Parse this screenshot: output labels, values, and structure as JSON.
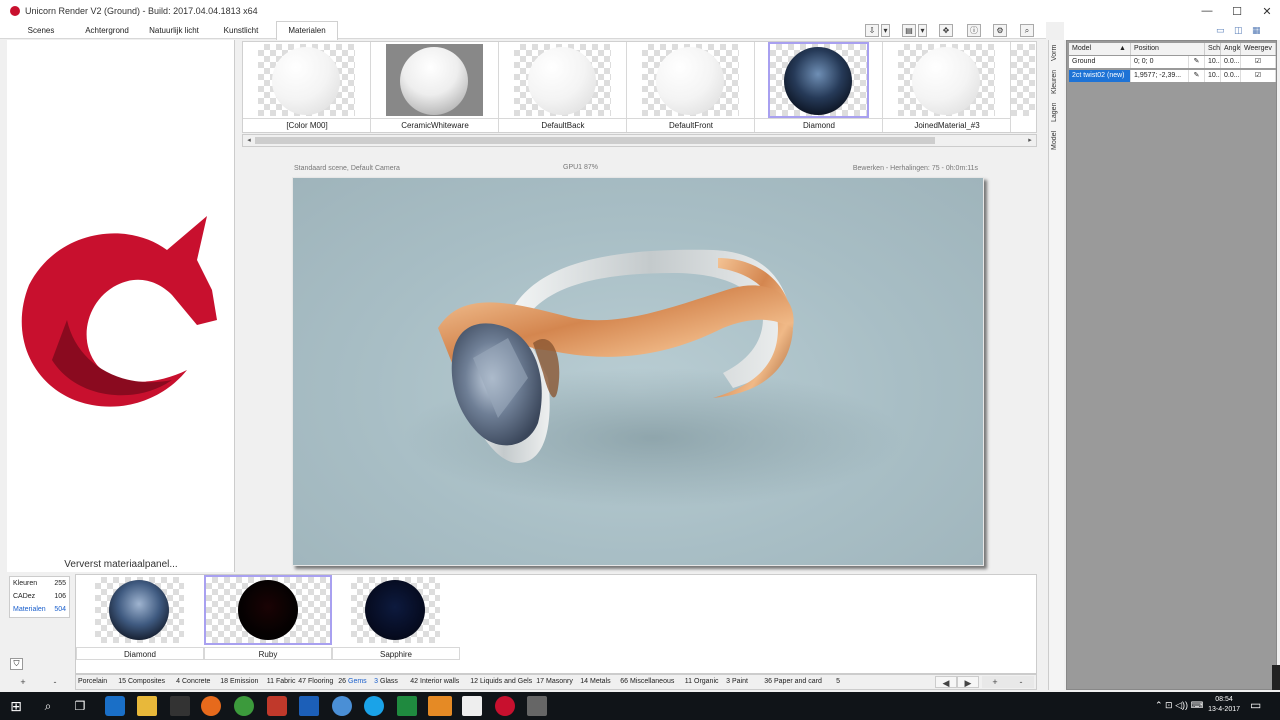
{
  "window": {
    "title": "Unicorn Render V2 (Ground) - Build: 2017.04.04.1813 x64",
    "minimize": "—",
    "maximize": "☐",
    "close": "✕"
  },
  "menu": {
    "tabs": [
      "Scenes",
      "Achtergrond",
      "Natuurlijk licht",
      "Kunstlicht",
      "Materialen"
    ],
    "active_index": 4
  },
  "materials_strip": {
    "items": [
      {
        "label": "[Color M00]",
        "ball": "white"
      },
      {
        "label": "CeramicWhiteware",
        "ball": "white-shadow"
      },
      {
        "label": "DefaultBack",
        "ball": "white"
      },
      {
        "label": "DefaultFront",
        "ball": "white"
      },
      {
        "label": "Diamond",
        "ball": "diamond"
      },
      {
        "label": "JoinedMaterial_#3",
        "ball": "white"
      }
    ],
    "selected_index": 4
  },
  "viewport": {
    "scene_info": "Standaard scene, Default Camera",
    "gpu_info": "GPU1 87%",
    "status_info": "Bewerken - Herhalingen: 75 - 0h:0m:11s"
  },
  "left_panel": {
    "refresh_label": "Ververst materiaalpanel..."
  },
  "library_list": [
    {
      "name": "Kleuren",
      "count": "255"
    },
    {
      "name": "CADez",
      "count": "106"
    },
    {
      "name": "Materialen",
      "count": "504"
    }
  ],
  "library_selected": 2,
  "gems": {
    "items": [
      {
        "label": "Diamond",
        "ball": "diamond"
      },
      {
        "label": "Ruby",
        "ball": "ruby"
      },
      {
        "label": "Sapphire",
        "ball": "sapphire"
      }
    ],
    "selected_index": 1
  },
  "categories": [
    {
      "name": "Porcelain",
      "count": "15"
    },
    {
      "name": "Composites",
      "count": "4"
    },
    {
      "name": "Concrete",
      "count": "18"
    },
    {
      "name": "Emission",
      "count": "11"
    },
    {
      "name": "Fabric",
      "count": "47"
    },
    {
      "name": "Flooring",
      "count": "26"
    },
    {
      "name": "Gems",
      "count": "3"
    },
    {
      "name": "Glass",
      "count": "42"
    },
    {
      "name": "Interior walls",
      "count": "12"
    },
    {
      "name": "Liquids and Gels",
      "count": "17"
    },
    {
      "name": "Masonry",
      "count": "14"
    },
    {
      "name": "Metals",
      "count": "66"
    },
    {
      "name": "Miscellaneous",
      "count": "11"
    },
    {
      "name": "Organic",
      "count": "3"
    },
    {
      "name": "Paint",
      "count": "36"
    },
    {
      "name": "Paper and card",
      "count": "5"
    }
  ],
  "categories_selected": 6,
  "bottom_controls": {
    "plus": "+",
    "minus": "-",
    "prev": "◀",
    "next": "▶"
  },
  "right_vtabs": [
    "Vorm",
    "Kleuren",
    "Lagen",
    "Model"
  ],
  "model_table": {
    "headers": [
      "Model",
      "Position",
      "Sch",
      "Angle",
      "Weergev"
    ],
    "sort_indicator": "▲",
    "rows": [
      {
        "model": "Ground",
        "position": "0; 0; 0",
        "scale": "10...",
        "angle": "0.0...",
        "visible": "☑"
      },
      {
        "model": "2ct twist02 (new)",
        "position": "1,9577; -2,39...",
        "scale": "10...",
        "angle": "0.0...",
        "visible": "☑"
      }
    ],
    "selected_row": 1
  },
  "taskbar": {
    "time": "08:54",
    "date": "13-4-2017"
  },
  "colors": {
    "brand_red": "#c8102e",
    "selection_blue": "#1e73d6",
    "selection_outline": "#a8a0f0"
  }
}
